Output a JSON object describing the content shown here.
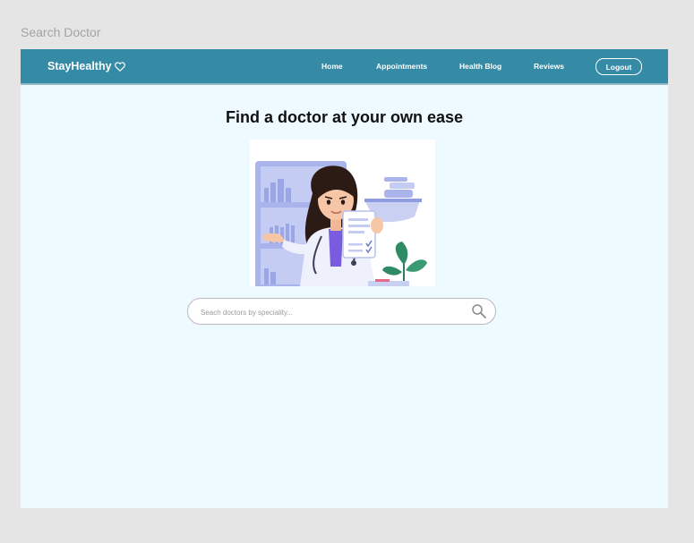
{
  "canvas": {
    "frame_label": "Search Doctor"
  },
  "navbar": {
    "brand": "StayHealthy",
    "links": [
      "Home",
      "Appointments",
      "Health Blog",
      "Reviews"
    ],
    "logout_label": "Logout"
  },
  "main": {
    "title": "Find a doctor at your own ease",
    "hero_image": "doctor-illustration",
    "search": {
      "placeholder": "Seach doctors by speciality...",
      "value": ""
    }
  },
  "colors": {
    "navbar": "#358aa6",
    "page_background": "#eefaff",
    "canvas_background": "#e5e5e5"
  },
  "icons": {
    "brand": "heart-icon",
    "search": "search-icon"
  }
}
